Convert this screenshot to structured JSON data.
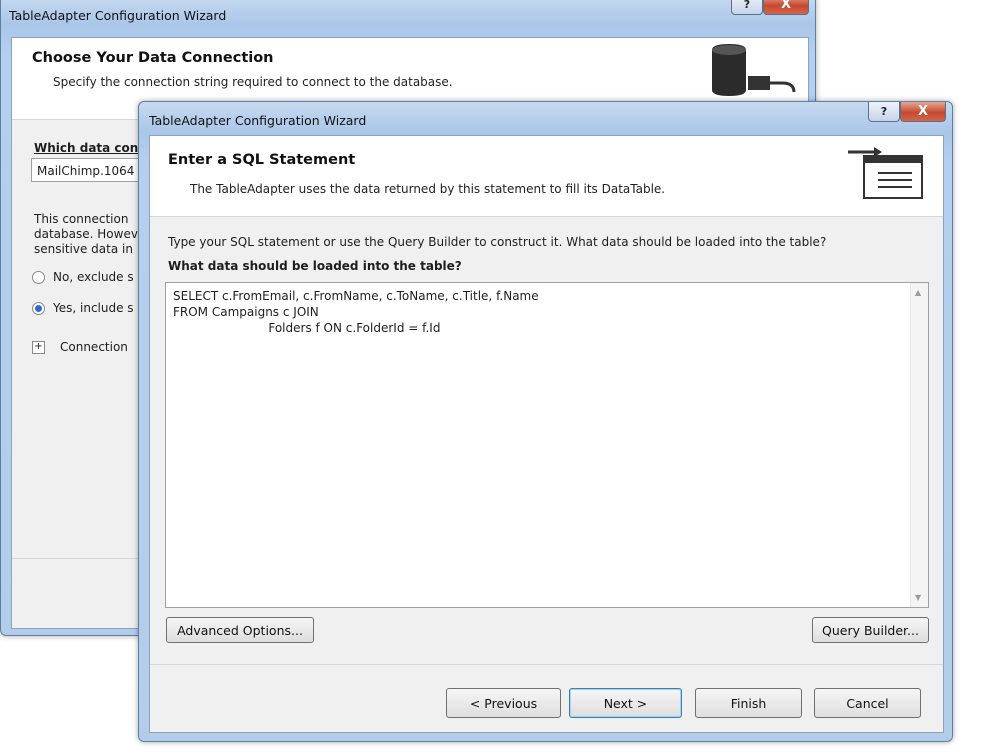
{
  "back_window": {
    "title": "TableAdapter Configuration Wizard",
    "help_label": "?",
    "close_label": "X",
    "header_title": "Choose Your Data Connection",
    "header_subtitle": "Specify the connection string required to connect to the database.",
    "which_label": "Which data conn",
    "combo_value": "MailChimp.1064",
    "info_line1": "This connection",
    "info_line2": "database. Howev",
    "info_line3": "sensitive data in",
    "radio_no": "No, exclude s",
    "radio_yes": "Yes, include s",
    "expander_symbol": "+",
    "expander_label": "Connection"
  },
  "front_window": {
    "title": "TableAdapter Configuration Wizard",
    "help_label": "?",
    "close_label": "X",
    "header_title": "Enter a SQL Statement",
    "header_subtitle": "The TableAdapter uses the data returned by this statement to fill its DataTable.",
    "instructions": "Type your SQL statement or use the Query Builder to construct it. What data should be loaded into the table?",
    "sql_label": "What data should be loaded into the table?",
    "sql_lines": [
      "SELECT c.FromEmail, c.FromName, c.ToName, c.Title, f.Name",
      "FROM Campaigns c JOIN",
      "                         Folders f ON c.FolderId = f.Id"
    ],
    "advanced_button": "Advanced Options...",
    "query_builder_button": "Query Builder...",
    "previous_button": "< Previous",
    "next_button": "Next >",
    "finish_button": "Finish",
    "cancel_button": "Cancel"
  }
}
